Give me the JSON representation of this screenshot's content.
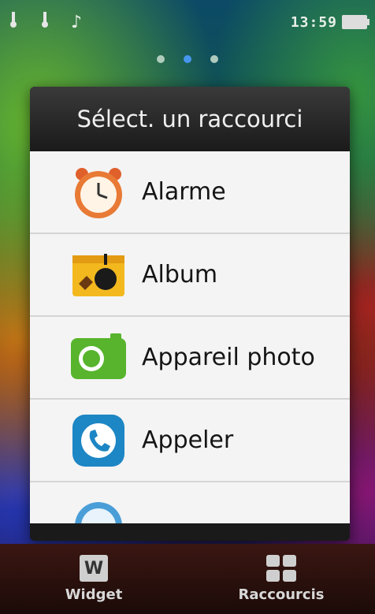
{
  "status_bar": {
    "icons": [
      "usb-icon",
      "usb-icon",
      "music-note-icon"
    ],
    "time": "13:59",
    "battery": "battery-icon"
  },
  "home_pages": {
    "count": 3,
    "active_index": 1
  },
  "dialog": {
    "title": "Sélect. un raccourci",
    "items": [
      {
        "label": "Alarme",
        "icon": "alarm-clock-icon"
      },
      {
        "label": "Album",
        "icon": "album-icon"
      },
      {
        "label": "Appareil photo",
        "icon": "camera-icon"
      },
      {
        "label": "Appeler",
        "icon": "phone-icon"
      }
    ]
  },
  "bottom_bar": {
    "tabs": [
      {
        "label": "Widget",
        "icon": "widget-icon",
        "icon_text": "W"
      },
      {
        "label": "Raccourcis",
        "icon": "shortcuts-icon"
      }
    ]
  },
  "colors": {
    "dialog_bg": "#1a1a1a",
    "list_bg": "#f4f4f4",
    "active_dot": "#4d9cff"
  }
}
